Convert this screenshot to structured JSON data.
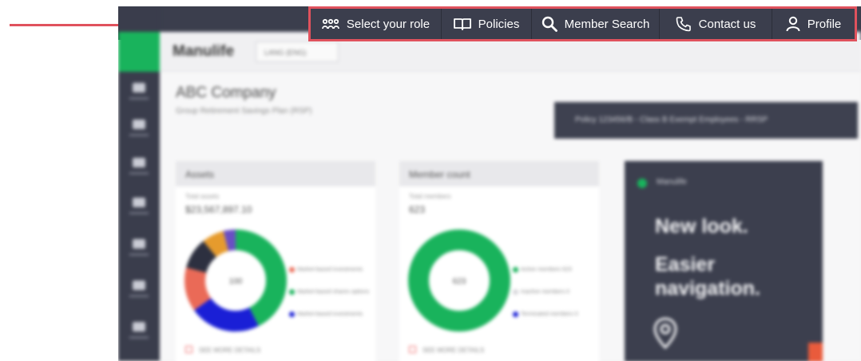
{
  "nav": {
    "select_role": "Select your role",
    "policies": "Policies",
    "member_search": "Member Search",
    "contact_us": "Contact us",
    "profile": "Profile"
  },
  "header": {
    "brand": "Manulife",
    "language_button": "LANG (ENG)"
  },
  "page": {
    "company": "ABC Company",
    "plan": "Group Retirement Savings Plan (RSP)",
    "policy_banner": "Policy 123456/B - Class B Exempt Employees - RRSP"
  },
  "assets_card": {
    "title": "Assets",
    "label": "Total assets",
    "value": "$23,567,897.10",
    "center": "100",
    "legend": [
      "Market-based investments",
      "Market-based shares options",
      "Market-based investments"
    ],
    "view_link": "SEE MORE DETAILS"
  },
  "member_card": {
    "title": "Member count",
    "label": "Total members",
    "value": "623",
    "center": "623",
    "legend": [
      "Active members 623",
      "Inactive members 0",
      "Terminated members 0"
    ],
    "view_link": "SEE MORE DETAILS"
  },
  "promo": {
    "brand": "Manulife",
    "line1": "New look.",
    "line2": "Easier",
    "line3": "navigation."
  },
  "colors": {
    "annotation": "#e0525d",
    "nav_bg": "#3b3e4d",
    "brand_green": "#19b35c"
  }
}
